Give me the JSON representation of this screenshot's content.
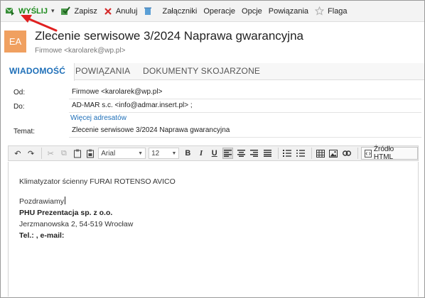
{
  "toolbar": {
    "send_label": "WYŚLIJ",
    "save_label": "Zapisz",
    "cancel_label": "Anuluj",
    "attachments_label": "Załączniki",
    "operations_label": "Operacje",
    "options_label": "Opcje",
    "links_label": "Powiązania",
    "flag_label": "Flaga"
  },
  "header": {
    "avatar_initials": "EA",
    "title": "Zlecenie serwisowe 3/2024 Naprawa gwarancyjna",
    "sender": "Firmowe <karolarek@wp.pl>"
  },
  "tabs": [
    {
      "label": "WIADOMOŚĆ",
      "active": true
    },
    {
      "label": "POWIĄZANIA",
      "active": false
    },
    {
      "label": "DOKUMENTY SKOJARZONE",
      "active": false
    }
  ],
  "form": {
    "from_label": "Od:",
    "from_value": "Firmowe <karolarek@wp.pl>",
    "to_label": "Do:",
    "to_value": "AD-MAR s.c. <info@admar.insert.pl> ;",
    "more_addresses": "Więcej adresatów",
    "subject_label": "Temat:",
    "subject_value": "Zlecenie serwisowe 3/2024 Naprawa gwarancyjna"
  },
  "editor": {
    "font_family": "Arial",
    "font_size": "12",
    "source_label": "Źródło HTML"
  },
  "body": {
    "line1": "Klimatyzator ścienny FURAI ROTENSO AVICO",
    "greeting": "Pozdrawiamy",
    "company": "PHU Prezentacja sp. z o.o.",
    "address": "Jerzmanowska 2, 54-519 Wrocław",
    "contact": "Tel.: , e-mail:"
  },
  "colors": {
    "accent_blue": "#1e6fb8",
    "send_green": "#1a8a1a",
    "avatar_orange": "#f0a060",
    "annotation_red": "#e02020"
  }
}
